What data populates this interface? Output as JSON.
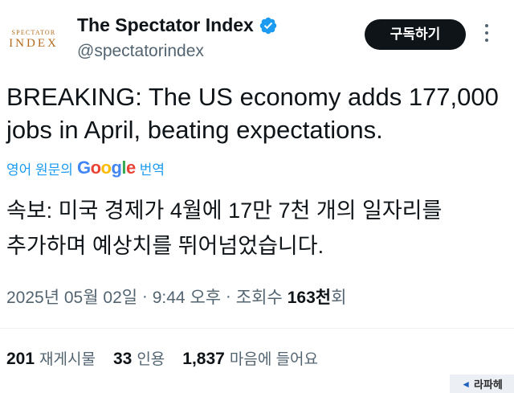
{
  "account": {
    "logo_line1": "SPECTATOR",
    "logo_line2": "INDEX",
    "display_name": "The Spectator Index",
    "handle": "@spectatorindex",
    "subscribe_label": "구독하기"
  },
  "tweet": {
    "text_line1": "BREAKING: The US economy adds 177,000",
    "text_line2": "jobs in April, beating expectations.",
    "translate_prefix": "영어 원문의",
    "translate_suffix": "번역",
    "translated_line1": "속보: 미국 경제가 4월에 17만 7천 개의 일자리를",
    "translated_line2": "추가하며 예상치를 뛰어넘었습니다."
  },
  "meta": {
    "date": "2025년 05월 02일",
    "sep1": " · ",
    "time": "9:44 오후",
    "sep2": " · ",
    "views_label": "조회수",
    "views_value": "163천",
    "views_suffix": "회"
  },
  "stats": {
    "reposts_count": "201",
    "reposts_label": "재게시물",
    "quotes_count": "33",
    "quotes_label": "인용",
    "likes_count": "1,837",
    "likes_label": "마음에 들어요"
  },
  "watermark": {
    "text": "라파헤"
  },
  "colors": {
    "verified_blue": "#1d9bf0",
    "logo_brown": "#b46a1b",
    "link_blue": "#1d9bf0",
    "muted_gray": "#536471",
    "button_black": "#0f1419"
  },
  "icons": {
    "verified": "verified-badge-icon",
    "more": "more-dots-icon",
    "google": "google-logo-icon"
  }
}
